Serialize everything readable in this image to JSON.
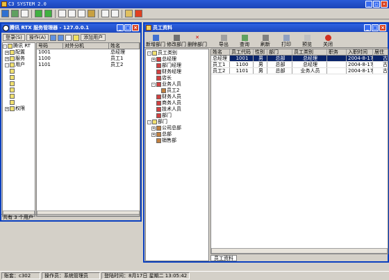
{
  "app": {
    "title": "C3 SYSTEM 2.0"
  },
  "status": {
    "account": "账套：c302",
    "operator": "操作员：系统管理员",
    "login_time": "登陆时间：8月17日 星期二 13:05:42"
  },
  "rtx": {
    "title": "腾讯 RTX 服务管理器 - 127.0.0.1",
    "login_btn": "登录(S)",
    "operate_btn": "操作(A)",
    "add_user_btn": "添加用户",
    "tree": [
      "腾讯 RT",
      "配置",
      "服务",
      "用户",
      "",
      "",
      "",
      "",
      "",
      "",
      "权限"
    ],
    "columns": [
      "号码",
      "对外分机",
      "姓名"
    ],
    "rows": [
      {
        "id": "1001",
        "ext": "",
        "name": "总经理"
      },
      {
        "id": "1100",
        "ext": "",
        "name": "员工1"
      },
      {
        "id": "1101",
        "ext": "",
        "name": "员工2"
      }
    ],
    "status": "共有 3 个用户"
  },
  "staff": {
    "title": "员工资料",
    "toolbar": [
      "新增部门",
      "修改部门",
      "删除部门",
      "导出",
      "查询",
      "刷新",
      "打印",
      "预览",
      "关闭"
    ],
    "tree": [
      "员工类别",
      "总经理",
      "部门经理",
      "财务经理",
      "店长",
      "业务人员",
      "员工2",
      "财务人员",
      "商务人员",
      "技术人员",
      "部门",
      "部门",
      "公司总部",
      "总部",
      "销售部"
    ],
    "columns": [
      "姓名",
      "员工代码",
      "性别",
      "部门",
      "员工类别",
      "职务",
      "入职时间",
      "居住"
    ],
    "rows": [
      {
        "name": "总经理",
        "code": "1001",
        "sex": "男",
        "dept": "总部",
        "cat": "总经理",
        "post": "",
        "date": "2004-8-17",
        "addr": "古"
      },
      {
        "name": "员工1",
        "code": "1100",
        "sex": "男",
        "dept": "总部",
        "cat": "总经理",
        "post": "",
        "date": "2004-8-17",
        "addr": "古"
      },
      {
        "name": "员工2",
        "code": "1101",
        "sex": "男",
        "dept": "总部",
        "cat": "业务人员",
        "post": "",
        "date": "2004-8-17",
        "addr": "古"
      }
    ],
    "sheet_tab": "员工资料"
  }
}
